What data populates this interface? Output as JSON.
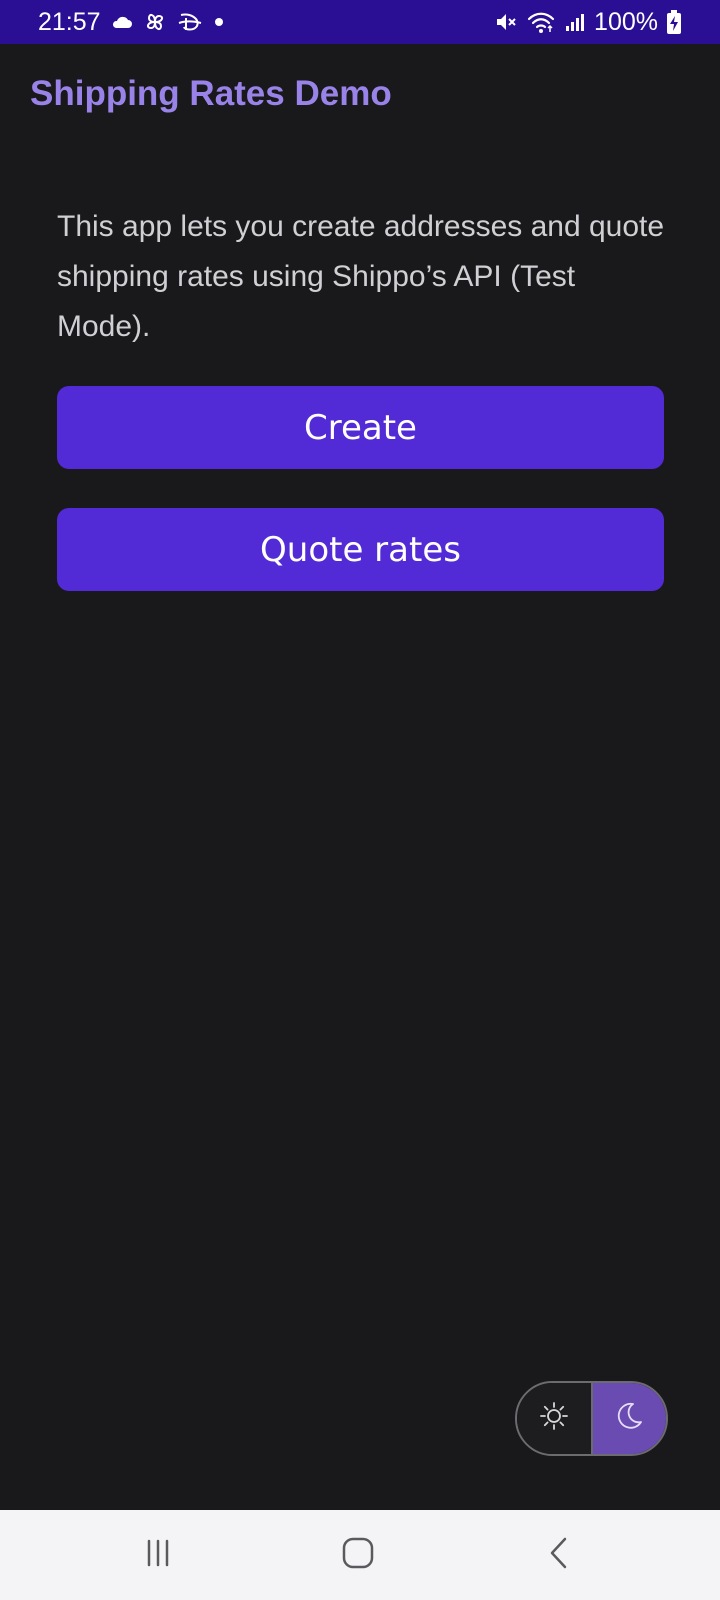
{
  "status_bar": {
    "time": "21:57",
    "battery": "100%",
    "left_icons": [
      "cloud-icon",
      "pinwheel-icon",
      "disney-icon",
      "dot-icon"
    ],
    "right_icons": [
      "mute-icon",
      "wifi-icon",
      "signal-icon",
      "battery-charging-icon"
    ]
  },
  "app": {
    "title": "Shipping Rates Demo"
  },
  "main": {
    "description": "This app lets you create addresses and quote shipping rates using Shippo’s API (Test Mode).",
    "create_label": "Create",
    "quote_label": "Quote rates"
  },
  "theme_toggle": {
    "options": [
      "light",
      "dark"
    ],
    "selected": "dark"
  },
  "nav_bar": {
    "buttons": [
      "recents",
      "home",
      "back"
    ]
  },
  "colors": {
    "status_bar": "#2a0e94",
    "background": "#19191b",
    "title": "#9a83e8",
    "button": "#522bd6",
    "toggle_active": "#6a4bb2",
    "nav_bar": "#f4f4f6"
  }
}
